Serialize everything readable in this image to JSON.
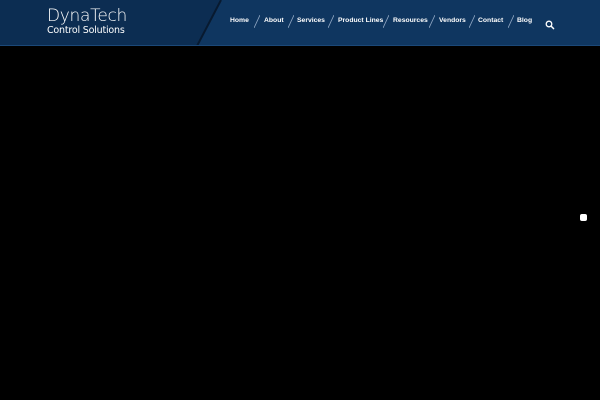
{
  "brand": {
    "name": "DynaTech",
    "tagline": "Control Solutions"
  },
  "nav": {
    "items": [
      {
        "label": "Home"
      },
      {
        "label": "About"
      },
      {
        "label": "Services"
      },
      {
        "label": "Product Lines"
      },
      {
        "label": "Resources"
      },
      {
        "label": "Vendors"
      },
      {
        "label": "Contact"
      },
      {
        "label": "Blog"
      }
    ],
    "search_icon": "search-icon"
  },
  "colors": {
    "header_bg": "#0e3259",
    "logo_panel_bg": "#0c2d52",
    "hero_bg": "#000000",
    "text": "#ffffff"
  },
  "slider": {
    "active_slide": 1
  }
}
